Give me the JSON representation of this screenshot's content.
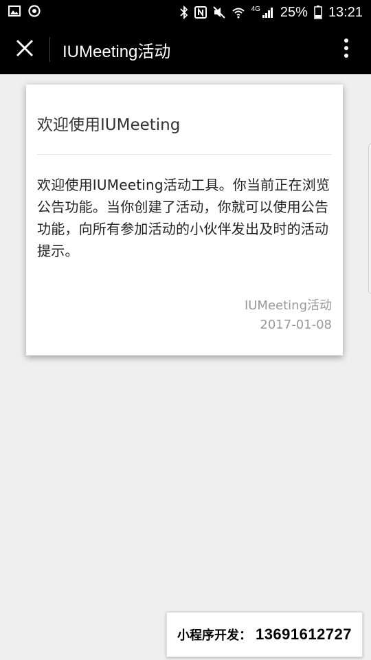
{
  "status_bar": {
    "battery": "25%",
    "time": "13:21",
    "network": "4G"
  },
  "app_bar": {
    "title": "IUMeeting活动"
  },
  "notice": {
    "title": "欢迎使用IUMeeting",
    "body": "欢迎使用IUMeeting活动工具。你当前正在浏览公告功能。当你创建了活动，你就可以使用公告功能，向所有参加活动的小伙伴发出及时的活动提示。",
    "author": "IUMeeting活动",
    "date": "2017-01-08"
  },
  "promo": {
    "label": "小程序开发：",
    "phone": "13691612727"
  },
  "icons": {
    "status_left": [
      "image-icon",
      "sync-icon"
    ],
    "status_right": [
      "bluetooth-icon",
      "nfc-icon",
      "mute-icon",
      "wifi-icon",
      "signal-icon",
      "battery-icon"
    ],
    "app_bar": [
      "close-icon",
      "more-vert-icon"
    ]
  },
  "colors": {
    "bars": "#000000",
    "background": "#efefef",
    "card": "#ffffff",
    "meta_text": "#999999"
  }
}
